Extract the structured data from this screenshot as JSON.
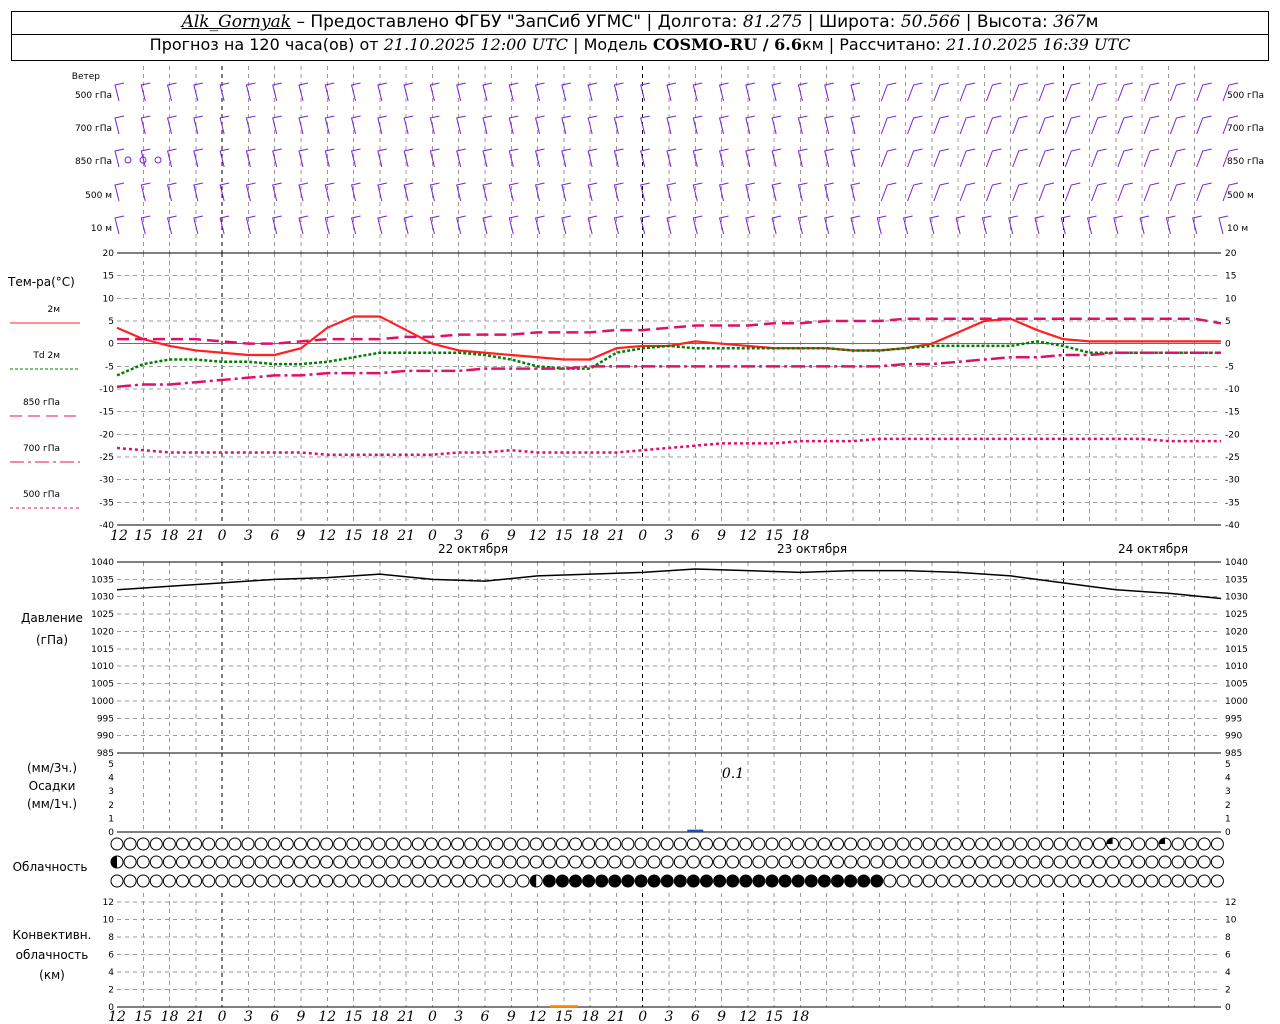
{
  "header": {
    "station": "Alk_Gornyak",
    "provider": " – Предоставлено ФГБУ \"ЗапСиб УГМС\" | Долгота: ",
    "lon": "81.275",
    "lat_label": " | Широта: ",
    "lat": "50.566",
    "alt_label": " | Высота: ",
    "alt": "367",
    "alt_unit": "м",
    "forecast_prefix": "Прогноз на 120 часа(ов) от ",
    "forecast_time": "21.10.2025 12:00 UTC",
    "model_prefix": " | Модель ",
    "model": "COSMO-RU / 6.6",
    "model_unit": "км",
    "calc_prefix": " | Рассчитано: ",
    "calc_time": "21.10.2025 16:39 UTC"
  },
  "labels": {
    "wind": "Ветер",
    "wind_levels": [
      "500 гПа",
      "700 гПа",
      "850 гПа",
      "500 м",
      "10 м"
    ],
    "temp": "Тем-ра(°С)",
    "legend": [
      {
        "text": "2м",
        "color": "#ff2020"
      },
      {
        "text": "Td  2м",
        "color": "#008000"
      },
      {
        "text": "850 гПа",
        "color": "#e0106a"
      },
      {
        "text": "700 гПа",
        "color": "#e0106a"
      },
      {
        "text": "500 гПа",
        "color": "#e0106a"
      }
    ],
    "pressure": "Давление",
    "pressure_unit": "(гПа)",
    "precip_top": "(мм/3ч.)",
    "precip_mid": "Осадки",
    "precip_bot": "(мм/1ч.)",
    "cloud": "Облачность",
    "conv1": "Конвективн.",
    "conv2": "облачность",
    "conv3": "(км)",
    "precip_value": "0.1"
  },
  "chart_data": [
    {
      "type": "line",
      "title": "Тем-ра(°С)",
      "x_hour_labels": [
        "12",
        "15",
        "18",
        "21",
        "0",
        "3",
        "6",
        "9",
        "12",
        "15",
        "18",
        "21",
        "0",
        "3",
        "6",
        "9",
        "12",
        "15",
        "18",
        "21",
        "0",
        "3",
        "6",
        "9",
        "12",
        "15",
        "18"
      ],
      "date_labels": [
        "22 октября",
        "23 октября",
        "24 октября"
      ],
      "ylim": [
        -40,
        20
      ],
      "yticks": [
        20,
        15,
        10,
        5,
        0,
        -5,
        -10,
        -15,
        -20,
        -25,
        -30,
        -35,
        -40
      ],
      "x": [
        0,
        3,
        6,
        9,
        12,
        15,
        18,
        21,
        24,
        27,
        30,
        33,
        36,
        39,
        42,
        45,
        48,
        51,
        54,
        57,
        60,
        63,
        66,
        69,
        72,
        75,
        78,
        81,
        84,
        87,
        90,
        93,
        96,
        99,
        102,
        105,
        108,
        111,
        114,
        117,
        120,
        123,
        126
      ],
      "series": [
        {
          "name": "2м",
          "color": "#ff2020",
          "dash": "",
          "values": [
            3.5,
            1,
            -0.5,
            -1.5,
            -2,
            -2.5,
            -2.5,
            -1,
            3.5,
            6,
            6,
            3,
            0,
            -1.5,
            -2,
            -2.5,
            -3,
            -3.5,
            -3.5,
            -1,
            -0.5,
            -0.5,
            0.5,
            0,
            -0.5,
            -1,
            -1,
            -1,
            -1.5,
            -1.5,
            -1,
            0,
            2.5,
            5,
            5.5,
            3,
            1,
            0.5,
            0.5,
            0.5,
            0.5,
            0.5,
            0.5
          ]
        },
        {
          "name": "Td 2м",
          "color": "#008000",
          "dash": "3,2",
          "values": [
            -7,
            -4.5,
            -3.5,
            -3.5,
            -4,
            -4,
            -4.5,
            -4.5,
            -4,
            -3,
            -2,
            -2,
            -2,
            -2,
            -2.5,
            -3.5,
            -5,
            -5.5,
            -5.5,
            -2,
            -1,
            -0.5,
            -1,
            -1,
            -1,
            -1,
            -1,
            -1,
            -1.5,
            -1.5,
            -1,
            -0.5,
            -0.5,
            -0.5,
            -0.5,
            0.5,
            -0.5,
            -2,
            -2,
            -2,
            -2,
            -2,
            -2
          ]
        },
        {
          "name": "850 гПа",
          "color": "#e0106a",
          "dash": "12,6",
          "values": [
            1,
            1,
            1,
            1,
            0.5,
            0,
            0,
            0.5,
            1,
            1,
            1,
            1.5,
            1.5,
            2,
            2,
            2,
            2.5,
            2.5,
            2.5,
            3,
            3,
            3.5,
            4,
            4,
            4,
            4.5,
            4.5,
            5,
            5,
            5,
            5.5,
            5.5,
            5.5,
            5.5,
            5.5,
            5.5,
            5.5,
            5.5,
            5.5,
            5.5,
            5.5,
            5.5,
            4.5
          ]
        },
        {
          "name": "700 гПа",
          "color": "#e0106a",
          "dash": "14,4,3,4",
          "values": [
            -9.5,
            -9,
            -9,
            -8.5,
            -8,
            -7.5,
            -7,
            -7,
            -6.5,
            -6.5,
            -6.5,
            -6,
            -6,
            -6,
            -5.5,
            -5.5,
            -5.5,
            -5.5,
            -5,
            -5,
            -5,
            -5,
            -5,
            -5,
            -5,
            -5,
            -5,
            -5,
            -5,
            -5,
            -4.5,
            -4.5,
            -4,
            -3.5,
            -3,
            -3,
            -2.5,
            -2.5,
            -2,
            -2,
            -2,
            -2,
            -2
          ]
        },
        {
          "name": "500 гПа",
          "color": "#e0106a",
          "dash": "3,3",
          "values": [
            -23,
            -23.5,
            -24,
            -24,
            -24,
            -24,
            -24,
            -24,
            -24.5,
            -24.5,
            -24.5,
            -24.5,
            -24.5,
            -24,
            -24,
            -23.5,
            -24,
            -24,
            -24,
            -24,
            -23.5,
            -23,
            -22.5,
            -22,
            -22,
            -22,
            -21.5,
            -21.5,
            -21.5,
            -21,
            -21,
            -21,
            -21,
            -21,
            -21,
            -21,
            -21,
            -21,
            -21,
            -21,
            -21.5,
            -21.5,
            -21.5
          ]
        }
      ]
    },
    {
      "type": "line",
      "title": "Давление",
      "ylabel": "(гПа)",
      "ylim": [
        985,
        1040
      ],
      "yticks": [
        1040,
        1035,
        1030,
        1025,
        1020,
        1015,
        1010,
        1005,
        1000,
        995,
        990,
        985
      ],
      "x": [
        0,
        6,
        12,
        18,
        24,
        30,
        36,
        42,
        48,
        54,
        60,
        66,
        72,
        78,
        84,
        90,
        96,
        102,
        108,
        114,
        120,
        126
      ],
      "series": [
        {
          "name": "",
          "color": "#000000",
          "values": [
            1032,
            1033,
            1034,
            1035,
            1035.5,
            1036.5,
            1035,
            1034.5,
            1036,
            1036.5,
            1037,
            1038,
            1037.5,
            1037,
            1037.5,
            1037.5,
            1037,
            1036,
            1034,
            1032,
            1031,
            1029.5
          ]
        }
      ]
    },
    {
      "type": "bar",
      "title": "Осадки",
      "ylim": [
        0,
        5
      ],
      "yticks": [
        5,
        4,
        3,
        2,
        1,
        0
      ],
      "annotation": "0.1",
      "x": [
        66
      ],
      "values": [
        0.1
      ]
    },
    {
      "type": "table",
      "title": "Облачность",
      "rows": [
        "high",
        "mid",
        "low"
      ],
      "cloud_cover_fraction": {
        "high": {
          "default": 0,
          "exceptions": {
            "114": 0.25,
            "120": 0.25
          }
        },
        "mid": {
          "default": 0,
          "exceptions": {
            "0": 0.5
          }
        },
        "low": {
          "default": 0,
          "ranges": [
            {
              "from": 48,
              "to": 49,
              "value": 0.5
            },
            {
              "from": 50,
              "to": 87,
              "value": 1
            }
          ]
        }
      }
    },
    {
      "type": "bar",
      "title": "Конвективн. облачность (км)",
      "ylim": [
        0,
        13
      ],
      "yticks": [
        12,
        10,
        8,
        6,
        4,
        2,
        0
      ],
      "x": [
        51
      ],
      "values": [
        0.1
      ]
    }
  ],
  "colors": {
    "wind": "#7a1fd6",
    "grid": "#9a9a9a",
    "zero_line": "#5a5aff",
    "precip_bar": "#1a4dbf",
    "conv_bar": "#ff8c00"
  }
}
